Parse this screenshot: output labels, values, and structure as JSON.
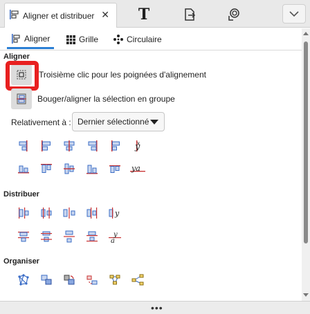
{
  "tabs": {
    "active_doc_tab": "Aligner et distribuer",
    "close_symbol": "✕",
    "text_tool_glyph": "T"
  },
  "subtabs": [
    {
      "label": "Aligner",
      "icon": "align-icon",
      "active": true
    },
    {
      "label": "Grille",
      "icon": "grid-icon",
      "active": false
    },
    {
      "label": "Circulaire",
      "icon": "circular-icon",
      "active": false
    }
  ],
  "align_section": {
    "title": "Aligner",
    "option1_label": "Troisième clic pour les poignées d'alignement",
    "option2_label": "Bouger/aligner la sélection en groupe",
    "relative_label": "Relativement à :",
    "relative_value": "Dernier sélectionné",
    "row1_icons": [
      "align-right-edge-to-left-anchor-icon",
      "align-left-edges-icon",
      "center-on-vertical-axis-icon",
      "align-right-edges-icon",
      "align-left-edge-to-right-anchor-icon",
      "align-text-anchors-horizontal-icon"
    ],
    "row2_icons": [
      "align-bottom-to-top-anchor-icon",
      "align-top-edges-icon",
      "center-on-horizontal-axis-icon",
      "align-bottom-edges-icon",
      "align-top-to-bottom-anchor-icon",
      "align-baselines-icon"
    ],
    "row2_last_glyph": "ya"
  },
  "distribute_section": {
    "title": "Distribuer",
    "row1_icons": [
      "distribute-left-edges-icon",
      "distribute-centers-horizontal-icon",
      "distribute-gaps-horizontal-icon",
      "distribute-right-edges-icon",
      "distribute-baselines-horizontal-icon"
    ],
    "row2_icons": [
      "distribute-top-edges-icon",
      "distribute-centers-vertical-icon",
      "distribute-gaps-vertical-icon",
      "distribute-bottom-edges-icon",
      "distribute-baselines-vertical-icon"
    ]
  },
  "arrange_section": {
    "title": "Organiser",
    "icons": [
      "rearrange-graph-icon",
      "exchange-positions-icon",
      "exchange-positions-clockwise-icon",
      "randomize-positions-icon",
      "unclump-icon",
      "remove-overlaps-icon"
    ]
  },
  "colors": {
    "accent": "#2a7fd4",
    "highlight_box": "#e82020",
    "icon_blue": "#3a6cc6",
    "icon_red": "#c83030"
  }
}
